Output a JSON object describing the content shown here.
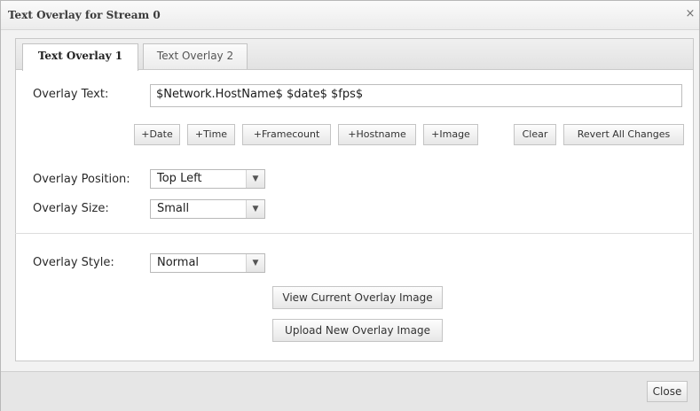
{
  "dialog": {
    "title": "Text Overlay for Stream 0",
    "close_icon": "×"
  },
  "tabs": [
    {
      "label": "Text Overlay 1",
      "active": true
    },
    {
      "label": "Text Overlay 2",
      "active": false
    }
  ],
  "overlay_text": {
    "label": "Overlay Text:",
    "value": "$Network.HostName$ $date$ $fps$"
  },
  "insert_buttons": {
    "date": "+Date",
    "time": "+Time",
    "framecount": "+Framecount",
    "hostname": "+Hostname",
    "image": "+Image",
    "clear": "Clear",
    "revert": "Revert All Changes"
  },
  "position": {
    "label": "Overlay Position:",
    "value": "Top Left"
  },
  "size": {
    "label": "Overlay Size:",
    "value": "Small"
  },
  "style": {
    "label": "Overlay Style:",
    "value": "Normal"
  },
  "image_buttons": {
    "view": "View Current Overlay Image",
    "upload": "Upload New Overlay Image"
  },
  "footer": {
    "close": "Close"
  },
  "icons": {
    "dropdown": "chevron-down-icon"
  }
}
